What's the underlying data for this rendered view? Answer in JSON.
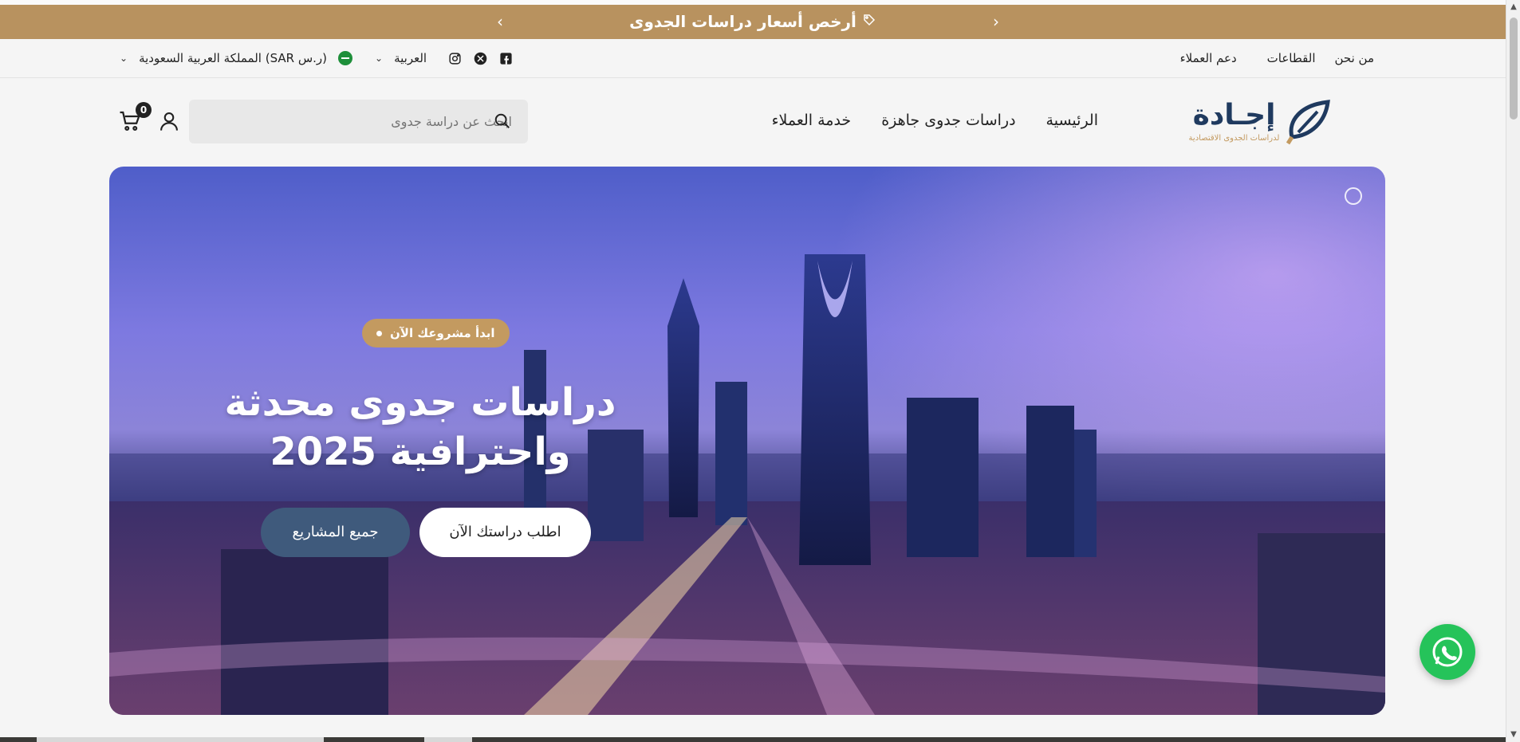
{
  "announcement": {
    "text": "أرخص أسعار دراسات الجدوى",
    "tag_icon": "tag-icon",
    "prev_icon": "chevron-left-icon",
    "next_icon": "chevron-right-icon"
  },
  "utility_bar": {
    "links": [
      "من نحن",
      "القطاعات",
      "دعم العملاء"
    ],
    "language": "العربية",
    "country_currency": "المملكة العربية السعودية (SAR ر.س)",
    "social_icons": [
      "instagram-icon",
      "x-icon",
      "facebook-icon"
    ]
  },
  "header": {
    "logo_title": "إجـادة",
    "logo_subtitle": "لدراسات الجدوى الاقتصادية",
    "nav": [
      "الرئيسية",
      "دراسات جدوى جاهزة",
      "خدمة العملاء"
    ],
    "search_placeholder": "ابحث عن دراسة جدوى",
    "cart_count": "0"
  },
  "hero": {
    "pill": "ابدأ مشروعك الآن",
    "headline_line1": "دراسات جدوى محدثة",
    "headline_line2": "واحترافية 2025",
    "primary_button": "اطلب دراستك الآن",
    "secondary_button": "جميع المشاريع"
  },
  "colors": {
    "announcement_bg": "#b8925f",
    "pill_bg": "#c39a60",
    "secondary_button_bg": "#3f5a7c",
    "whatsapp": "#25c35a",
    "logo_navy": "#1f3a5f"
  }
}
